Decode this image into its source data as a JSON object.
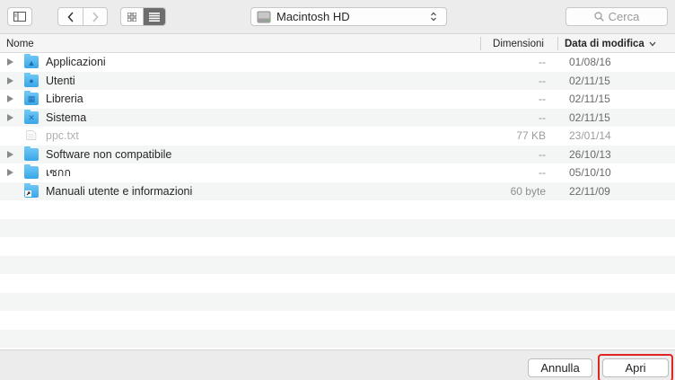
{
  "toolbar": {
    "location": "Macintosh HD",
    "search_placeholder": "Cerca"
  },
  "header": {
    "name_col": "Nome",
    "size_col": "Dimensioni",
    "date_col": "Data di modifica"
  },
  "rows": [
    {
      "name": "Applicazioni",
      "size": "--",
      "date": "01/08/16",
      "icon": "applications-folder-icon"
    },
    {
      "name": "Utenti",
      "size": "--",
      "date": "02/11/15",
      "icon": "users-folder-icon"
    },
    {
      "name": "Libreria",
      "size": "--",
      "date": "02/11/15",
      "icon": "library-folder-icon"
    },
    {
      "name": "Sistema",
      "size": "--",
      "date": "02/11/15",
      "icon": "system-folder-icon"
    },
    {
      "name": "ppc.txt",
      "size": "77 KB",
      "date": "23/01/14",
      "icon": "text-file-icon"
    },
    {
      "name": "Software non compatibile",
      "size": "--",
      "date": "26/10/13",
      "icon": "folder-icon"
    },
    {
      "name": "เซกก",
      "size": "--",
      "date": "05/10/10",
      "icon": "folder-icon"
    },
    {
      "name": "Manuali utente e informazioni",
      "size": "60 byte",
      "date": "22/11/09",
      "icon": "alias-folder-icon"
    }
  ],
  "buttons": {
    "cancel": "Annulla",
    "open": "Apri"
  },
  "colors": {
    "highlight": "#e02424",
    "folder": "#4ab3ef"
  }
}
